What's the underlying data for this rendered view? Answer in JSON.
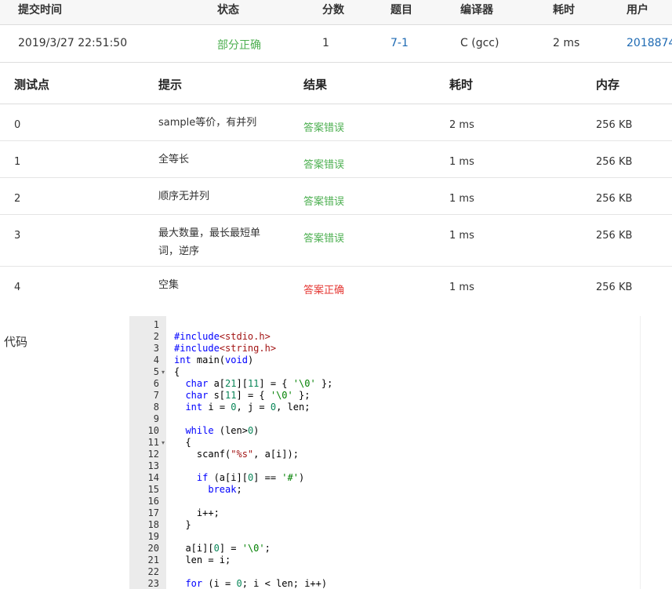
{
  "submission": {
    "headers": {
      "time": "提交时间",
      "status": "状态",
      "score": "分数",
      "problem": "题目",
      "compiler": "编译器",
      "duration": "耗时",
      "user": "用户"
    },
    "row": {
      "time": "2019/3/27 22:51:50",
      "status": "部分正确",
      "score": "1",
      "problem": "7-1",
      "compiler": "C (gcc)",
      "duration": "2 ms",
      "user": "2018874"
    }
  },
  "testcases": {
    "headers": {
      "point": "测试点",
      "hint": "提示",
      "result": "结果",
      "duration": "耗时",
      "memory": "内存"
    },
    "rows": [
      {
        "point": "0",
        "hint": "sample等价，有并列",
        "result": "答案错误",
        "duration": "2 ms",
        "memory": "256 KB"
      },
      {
        "point": "1",
        "hint": "全等长",
        "result": "答案错误",
        "duration": "1 ms",
        "memory": "256 KB"
      },
      {
        "point": "2",
        "hint": "顺序无并列",
        "result": "答案错误",
        "duration": "1 ms",
        "memory": "256 KB"
      },
      {
        "point": "3",
        "hint": "最大数量，最长最短单词，逆序",
        "result": "答案错误",
        "duration": "1 ms",
        "memory": "256 KB"
      },
      {
        "point": "4",
        "hint": "空集",
        "result": "答案正确",
        "duration": "1 ms",
        "memory": "256 KB"
      }
    ]
  },
  "code_section": {
    "label": "代码",
    "line_numbers": [
      "1",
      "2",
      "3",
      "4",
      "5",
      "6",
      "7",
      "8",
      "9",
      "10",
      "11",
      "12",
      "13",
      "14",
      "15",
      "16",
      "17",
      "18",
      "19",
      "20",
      "21",
      "22",
      "23"
    ],
    "fold_lines": [
      "5",
      "11"
    ],
    "lines": [
      "",
      "#include<stdio.h>",
      "#include<string.h>",
      "int main(void)",
      "{",
      "  char a[21][11] = { '\\0' };",
      "  char s[11] = { '\\0' };",
      "  int i = 0, j = 0, len;",
      "",
      "  while (len>0)",
      "  {",
      "    scanf(\"%s\", a[i]);",
      "",
      "    if (a[i][0] == '#')",
      "      break;",
      "",
      "    i++;",
      "  }",
      "",
      "  a[i][0] = '\\0';",
      "  len = i;",
      "",
      "  for (i = 0; i < len; i++)"
    ]
  },
  "colors": {
    "partial": "#4caf50",
    "wrong": "#4caf50",
    "correct": "#e53935",
    "link": "#1e6ab3"
  }
}
